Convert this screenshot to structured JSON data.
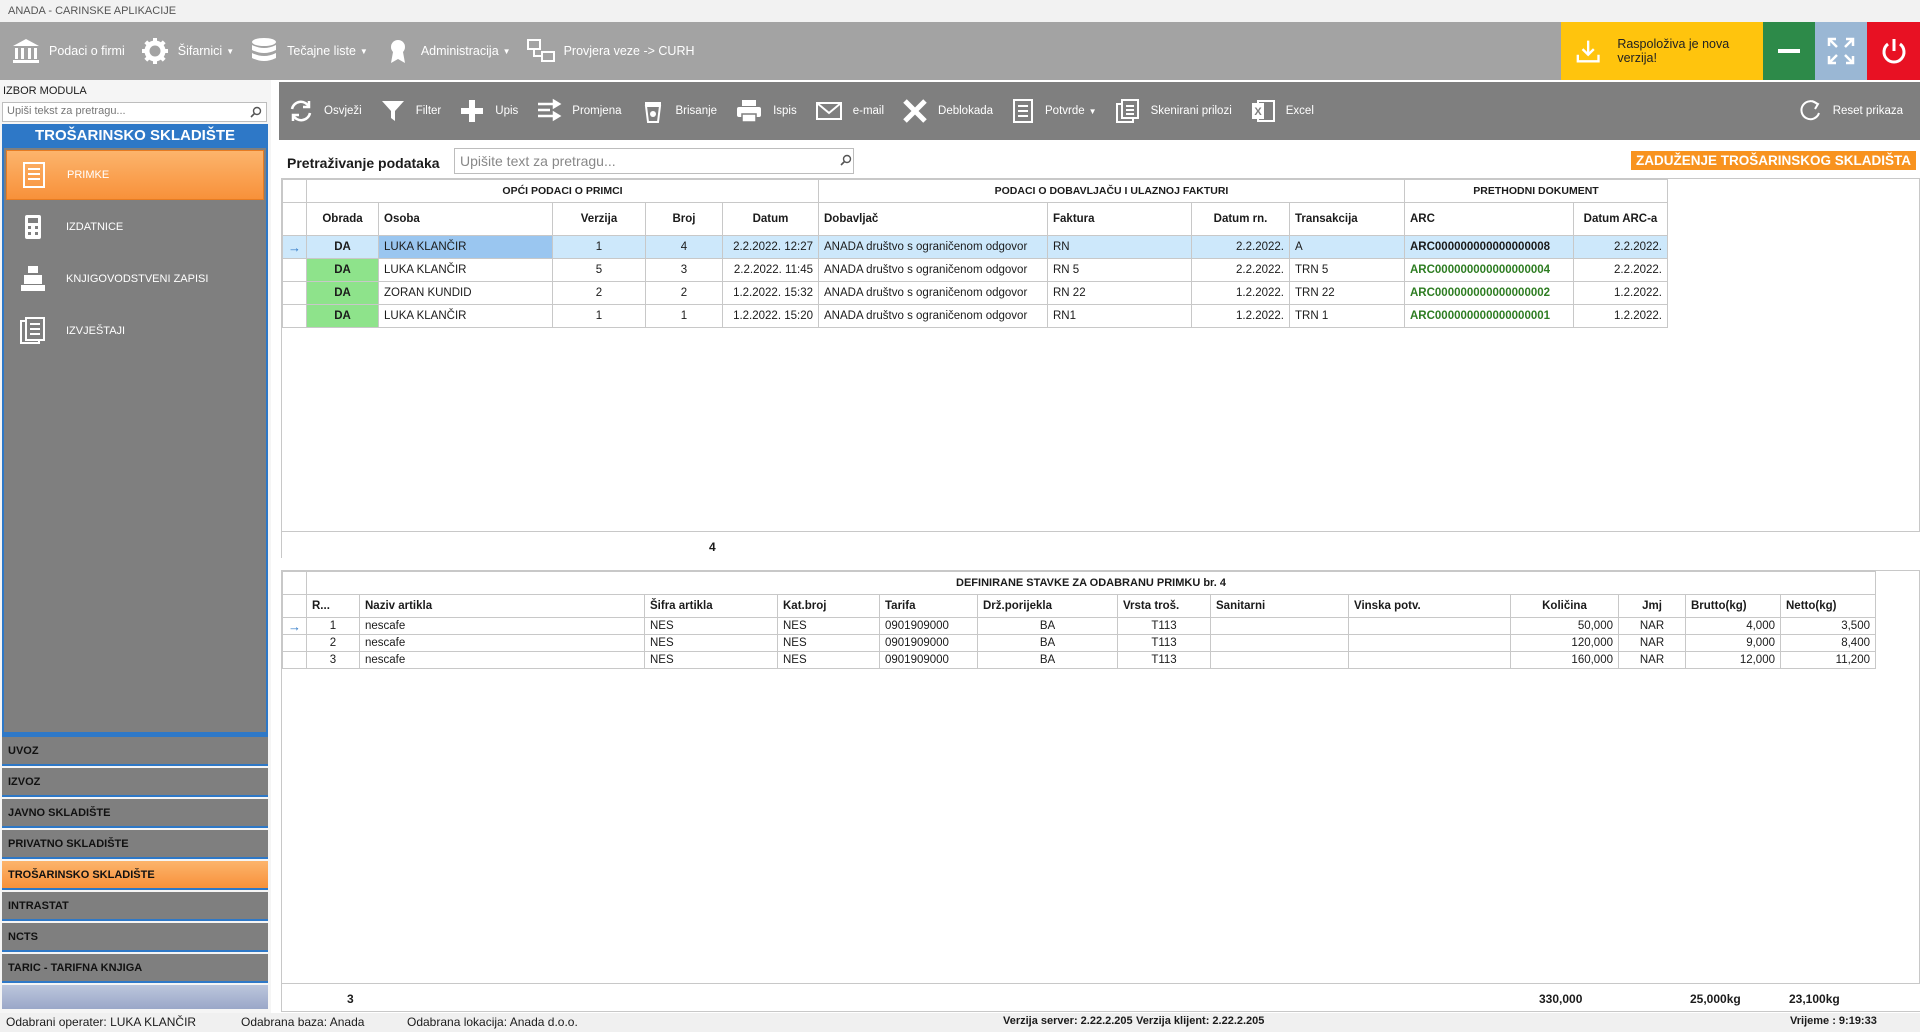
{
  "app_title": "ANADA - CARINSKE APLIKACIJE",
  "topbar": {
    "items": [
      {
        "label": "Podaci o firmi",
        "icon": "bank-icon",
        "caret": false
      },
      {
        "label": "Šifarnici",
        "icon": "gear-icon",
        "caret": true
      },
      {
        "label": "Tečajne liste",
        "icon": "database-icon",
        "caret": true
      },
      {
        "label": "Administracija",
        "icon": "award-icon",
        "caret": true
      },
      {
        "label": "Provjera veze -> CURH",
        "icon": "network-icon",
        "caret": false
      }
    ],
    "update_label": "Raspoloživa je nova verzija!"
  },
  "sidebar": {
    "label": "IZBOR MODULA",
    "search_placeholder": "Upiši tekst za pretragu...",
    "module_title": "TROŠARINSKO SKLADIŠTE",
    "items": [
      {
        "label": "PRIMKE",
        "icon": "document-icon",
        "active": true
      },
      {
        "label": "IZDATNICE",
        "icon": "calculator-icon",
        "active": false
      },
      {
        "label": "KNJIGOVODSTVENI ZAPISI",
        "icon": "cash-register-icon",
        "active": false
      },
      {
        "label": "IZVJEŠTAJI",
        "icon": "reports-icon",
        "active": false
      }
    ],
    "categories": [
      {
        "label": "UVOZ",
        "active": false
      },
      {
        "label": "IZVOZ",
        "active": false
      },
      {
        "label": "JAVNO SKLADIŠTE",
        "active": false
      },
      {
        "label": "PRIVATNO SKLADIŠTE",
        "active": false
      },
      {
        "label": "TROŠARINSKO SKLADIŠTE",
        "active": true
      },
      {
        "label": "INTRASTAT",
        "active": false
      },
      {
        "label": "NCTS",
        "active": false
      },
      {
        "label": "TARIC - TARIFNA KNJIGA",
        "active": false
      }
    ]
  },
  "toolbar": {
    "buttons": [
      {
        "label": "Osvježi",
        "icon": "refresh-icon"
      },
      {
        "label": "Filter",
        "icon": "filter-icon"
      },
      {
        "label": "Upis",
        "icon": "plus-icon"
      },
      {
        "label": "Promjena",
        "icon": "edit-icon"
      },
      {
        "label": "Brisanje",
        "icon": "trash-icon"
      },
      {
        "label": "Ispis",
        "icon": "printer-icon"
      },
      {
        "label": "e-mail",
        "icon": "mail-icon"
      },
      {
        "label": "Deblokada",
        "icon": "x-icon"
      },
      {
        "label": "Potvrde",
        "icon": "receipt-icon"
      },
      {
        "label": "Skenirani prilozi",
        "icon": "pages-icon"
      },
      {
        "label": "Excel",
        "icon": "excel-icon"
      }
    ],
    "reset_label": "Reset prikaza"
  },
  "search": {
    "label": "Pretraživanje podataka",
    "placeholder": "Upišite text za pretragu..."
  },
  "badge": "ZADUŽENJE TROŠARINSKOG SKLADIŠTA",
  "grid1": {
    "groups": [
      "OPĆI PODACI O PRIMCI",
      "PODACI O DOBAVLJAČU I ULAZNOJ FAKTURI",
      "PRETHODNI DOKUMENT"
    ],
    "columns": [
      "Obrada",
      "Osoba",
      "Verzija",
      "Broj",
      "Datum",
      "Dobavljač",
      "Faktura",
      "Datum rn.",
      "Transakcija",
      "ARC",
      "Datum ARC-a"
    ],
    "rows": [
      {
        "obrada": "DA",
        "osoba": "LUKA KLANČIR",
        "verzija": "1",
        "broj": "4",
        "datum": "2.2.2022. 12:27",
        "dobavljac": "ANADA društvo s ograničenom odgovor",
        "faktura": "RN",
        "datum_rn": "2.2.2022.",
        "transakcija": "A",
        "arc": "ARC000000000000000008",
        "datum_arc": "2.2.2022."
      },
      {
        "obrada": "DA",
        "osoba": "LUKA KLANČIR",
        "verzija": "5",
        "broj": "3",
        "datum": "2.2.2022. 11:45",
        "dobavljac": "ANADA društvo s ograničenom odgovor",
        "faktura": "RN 5",
        "datum_rn": "2.2.2022.",
        "transakcija": "TRN 5",
        "arc": "ARC000000000000000004",
        "datum_arc": "2.2.2022."
      },
      {
        "obrada": "DA",
        "osoba": "ZORAN KUNDID",
        "verzija": "2",
        "broj": "2",
        "datum": "1.2.2022. 15:32",
        "dobavljac": "ANADA društvo s ograničenom odgovor",
        "faktura": "RN 22",
        "datum_rn": "1.2.2022.",
        "transakcija": "TRN 22",
        "arc": "ARC000000000000000002",
        "datum_arc": "1.2.2022."
      },
      {
        "obrada": "DA",
        "osoba": "LUKA KLANČIR",
        "verzija": "1",
        "broj": "1",
        "datum": "1.2.2022. 15:20",
        "dobavljac": "ANADA društvo s ograničenom odgovor",
        "faktura": "RN1",
        "datum_rn": "1.2.2022.",
        "transakcija": "TRN 1",
        "arc": "ARC000000000000000001",
        "datum_arc": "1.2.2022."
      }
    ],
    "footer_count": "4"
  },
  "grid2": {
    "title": "DEFINIRANE STAVKE ZA ODABRANU PRIMKU br. 4",
    "columns": [
      "R...",
      "Naziv artikla",
      "Šifra artikla",
      "Kat.broj",
      "Tarifa",
      "Drž.porijekla",
      "Vrsta troš.",
      "Sanitarni",
      "Vinska potv.",
      "Količina",
      "Jmj",
      "Brutto(kg)",
      "Netto(kg)"
    ],
    "rows": [
      {
        "rb": "1",
        "naziv": "nescafe",
        "sifra": "NES",
        "kat": "NES",
        "tarifa": "0901909000",
        "drz": "BA",
        "vrsta": "T113",
        "san": "",
        "vin": "",
        "kol": "50,000",
        "jmj": "NAR",
        "brutto": "4,000",
        "netto": "3,500"
      },
      {
        "rb": "2",
        "naziv": "nescafe",
        "sifra": "NES",
        "kat": "NES",
        "tarifa": "0901909000",
        "drz": "BA",
        "vrsta": "T113",
        "san": "",
        "vin": "",
        "kol": "120,000",
        "jmj": "NAR",
        "brutto": "9,000",
        "netto": "8,400"
      },
      {
        "rb": "3",
        "naziv": "nescafe",
        "sifra": "NES",
        "kat": "NES",
        "tarifa": "0901909000",
        "drz": "BA",
        "vrsta": "T113",
        "san": "",
        "vin": "",
        "kol": "160,000",
        "jmj": "NAR",
        "brutto": "12,000",
        "netto": "11,200"
      }
    ],
    "footer": {
      "count": "3",
      "kolicina": "330,000",
      "brutto": "25,000kg",
      "netto": "23,100kg"
    }
  },
  "status": {
    "operater": "Odabrani operater: LUKA KLANČIR",
    "baza": "Odabrana baza: Anada",
    "lokacija": "Odabrana lokacija: Anada d.o.o.",
    "verzija_server": "Verzija server: 2.22.2.205",
    "verzija_klijent": "Verzija klijent: 2.22.2.205",
    "vrijeme": "Vrijeme : 9:19:33"
  },
  "colors": {
    "accent_blue": "#2e78c7",
    "orange": "#f8931f",
    "green_da": "#8ee38b",
    "arc_green": "#2e7d22"
  }
}
